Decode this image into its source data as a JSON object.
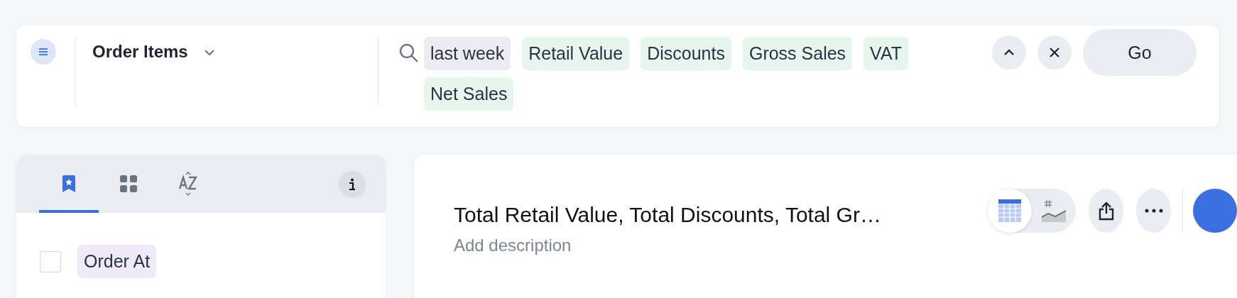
{
  "source": {
    "title": "Order Items"
  },
  "search": {
    "tokens": [
      {
        "text": "last week",
        "kind": "keyword"
      },
      {
        "text": "Retail Value",
        "kind": "column"
      },
      {
        "text": "Discounts",
        "kind": "column"
      },
      {
        "text": "Gross Sales",
        "kind": "column"
      },
      {
        "text": "VAT",
        "kind": "column"
      },
      {
        "text": "Net Sales",
        "kind": "column"
      }
    ],
    "go_button": "Go"
  },
  "sidebar": {
    "tabs": [
      {
        "kind": "bookmark",
        "selected": true
      },
      {
        "kind": "grid",
        "selected": false
      },
      {
        "kind": "sort",
        "selected": false
      }
    ],
    "items": [
      {
        "label": "Order At",
        "checked": false
      }
    ]
  },
  "answer": {
    "title": "Total Retail Value, Total Discounts, Total Gr…",
    "description_placeholder": "Add description",
    "views": [
      {
        "kind": "table",
        "selected": true
      },
      {
        "kind": "chart",
        "selected": false
      }
    ]
  }
}
